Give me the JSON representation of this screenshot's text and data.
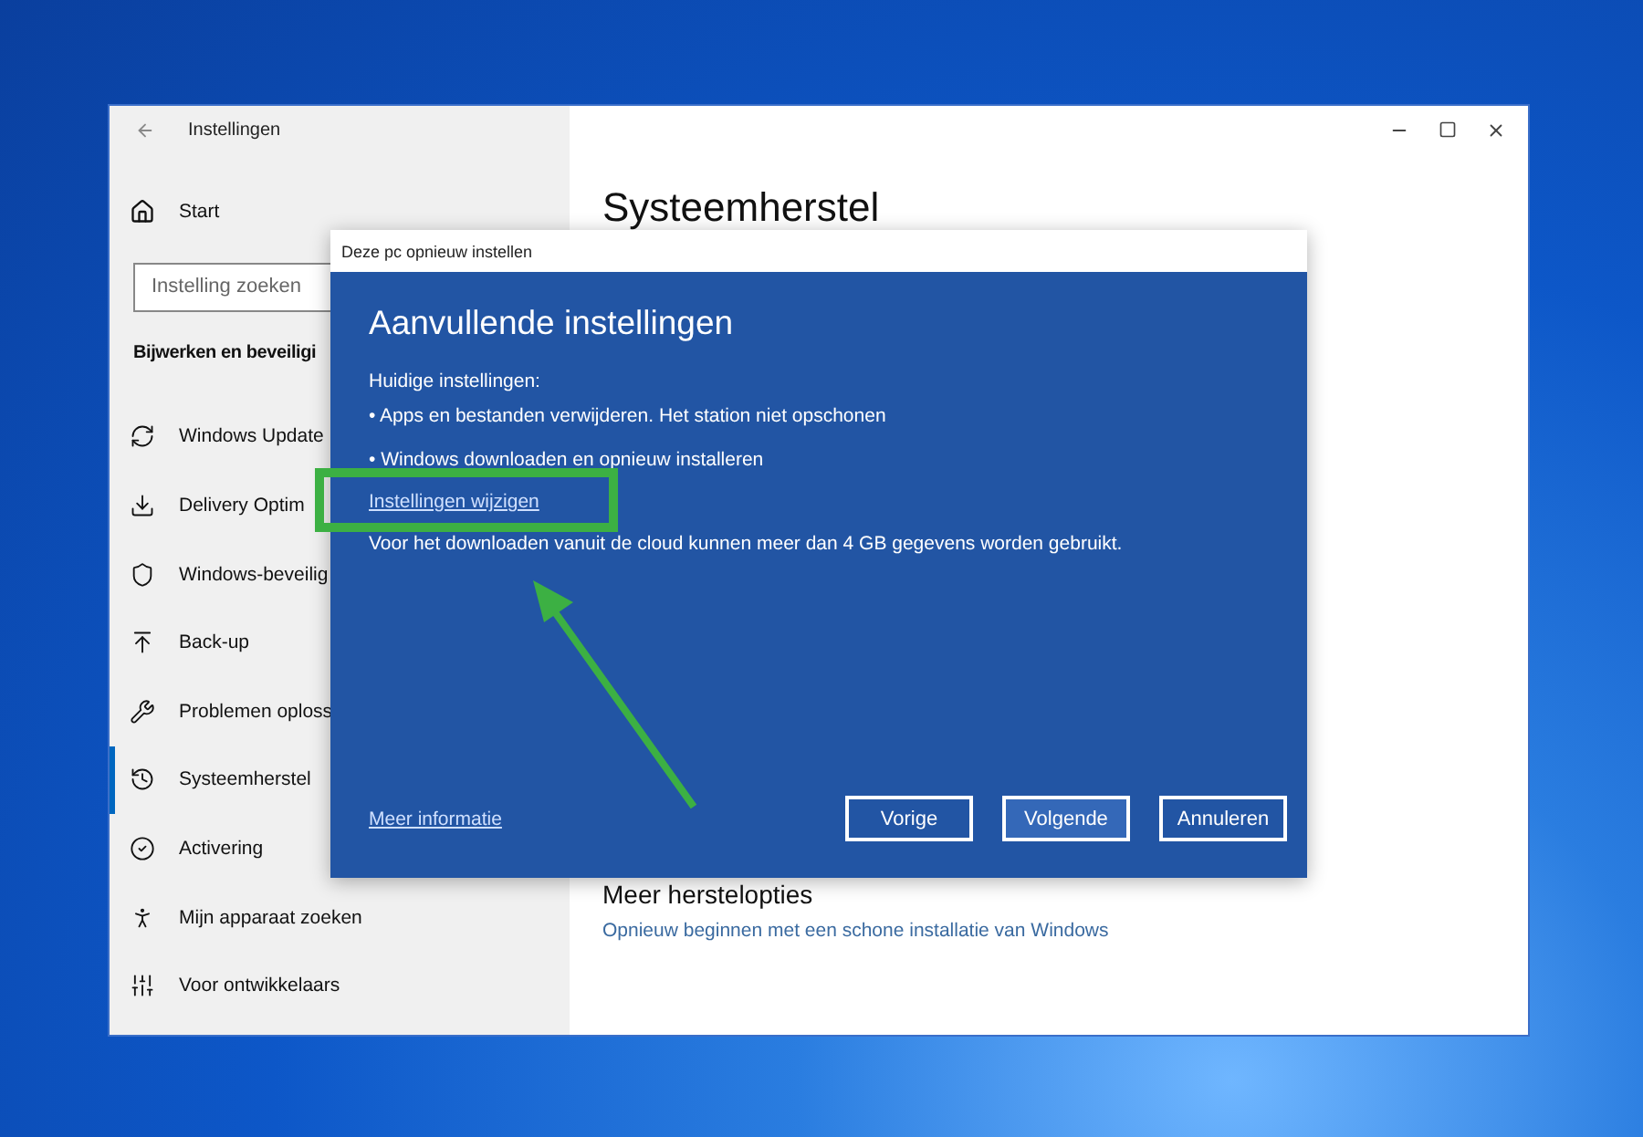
{
  "window": {
    "title": "Instellingen"
  },
  "sidebar": {
    "start": "Start",
    "search": {
      "placeholder": "Instelling zoeken"
    },
    "section": "Bijwerken en beveiligi",
    "items": [
      {
        "label": "Windows Update",
        "kind": "sync",
        "selected": false
      },
      {
        "label": "Delivery Optim",
        "kind": "delivery",
        "selected": false
      },
      {
        "label": "Windows-beveilig",
        "kind": "shield",
        "selected": false
      },
      {
        "label": "Back-up",
        "kind": "backup",
        "selected": false
      },
      {
        "label": "Problemen oploss",
        "kind": "wrench",
        "selected": false
      },
      {
        "label": "Systeemherstel",
        "kind": "recovery",
        "selected": true
      },
      {
        "label": "Activering",
        "kind": "check",
        "selected": false
      },
      {
        "label": "Mijn apparaat zoeken",
        "kind": "person",
        "selected": false
      },
      {
        "label": "Voor ontwikkelaars",
        "kind": "tools",
        "selected": false
      }
    ]
  },
  "main": {
    "heading": "Systeemherstel",
    "subheading": "Meer herstelopties",
    "link": "Opnieuw beginnen met een schone installatie van Windows"
  },
  "dialog": {
    "title": "Deze pc opnieuw instellen",
    "heading": "Aanvullende instellingen",
    "current_label": "Huidige instellingen:",
    "bullets": [
      "• Apps en bestanden verwijderen. Het station niet opschonen",
      "• Windows downloaden en opnieuw installeren"
    ],
    "change_link": "Instellingen wijzigen",
    "note": "Voor het downloaden vanuit de cloud kunnen meer dan 4 GB gegevens worden gebruikt.",
    "more_link": "Meer informatie",
    "buttons": [
      {
        "label": "Vorige",
        "selected": false
      },
      {
        "label": "Volgende",
        "selected": true
      },
      {
        "label": "Annuleren",
        "selected": false
      }
    ]
  }
}
